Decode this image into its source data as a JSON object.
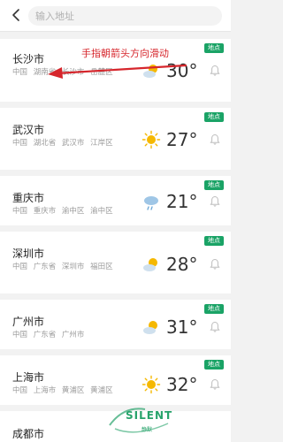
{
  "search": {
    "placeholder": "输入地址"
  },
  "annotation": "手指朝箭头方向滑动",
  "watermark": {
    "brand": "SILENT",
    "subtitle": "静默"
  },
  "cities": [
    {
      "name": "长沙市",
      "address_line1": "中国 湖南省 长沙市 岳麓区",
      "address_line2": "岳麓区",
      "badge": "地点",
      "temperature": "30°",
      "weather_icon": "partly-cloudy-icon"
    },
    {
      "name": "武汉市",
      "address_line1": "中国 湖北省 武汉市 江岸区",
      "address_line2": "江岸区",
      "badge": "地点",
      "temperature": "27°",
      "weather_icon": "sunny-icon"
    },
    {
      "name": "重庆市",
      "address_line1": "中国 重庆市 渝中区 渝中区",
      "address_line2": "",
      "badge": "地点",
      "temperature": "21°",
      "weather_icon": "rain-cloud-icon"
    },
    {
      "name": "深圳市",
      "address_line1": "中国 广东省 深圳市 福田区",
      "address_line2": "福田区",
      "badge": "地点",
      "temperature": "28°",
      "weather_icon": "partly-cloudy-icon"
    },
    {
      "name": "广州市",
      "address_line1": "中国 广东省 广州市",
      "address_line2": "",
      "badge": "地点",
      "temperature": "31°",
      "weather_icon": "partly-cloudy-icon"
    },
    {
      "name": "上海市",
      "address_line1": "中国 上海市 黄浦区 黄浦区",
      "address_line2": "",
      "badge": "地点",
      "temperature": "32°",
      "weather_icon": "sunny-icon"
    },
    {
      "name": "成都市",
      "address_line1": "",
      "address_line2": "",
      "badge": "",
      "temperature": "",
      "weather_icon": ""
    }
  ]
}
